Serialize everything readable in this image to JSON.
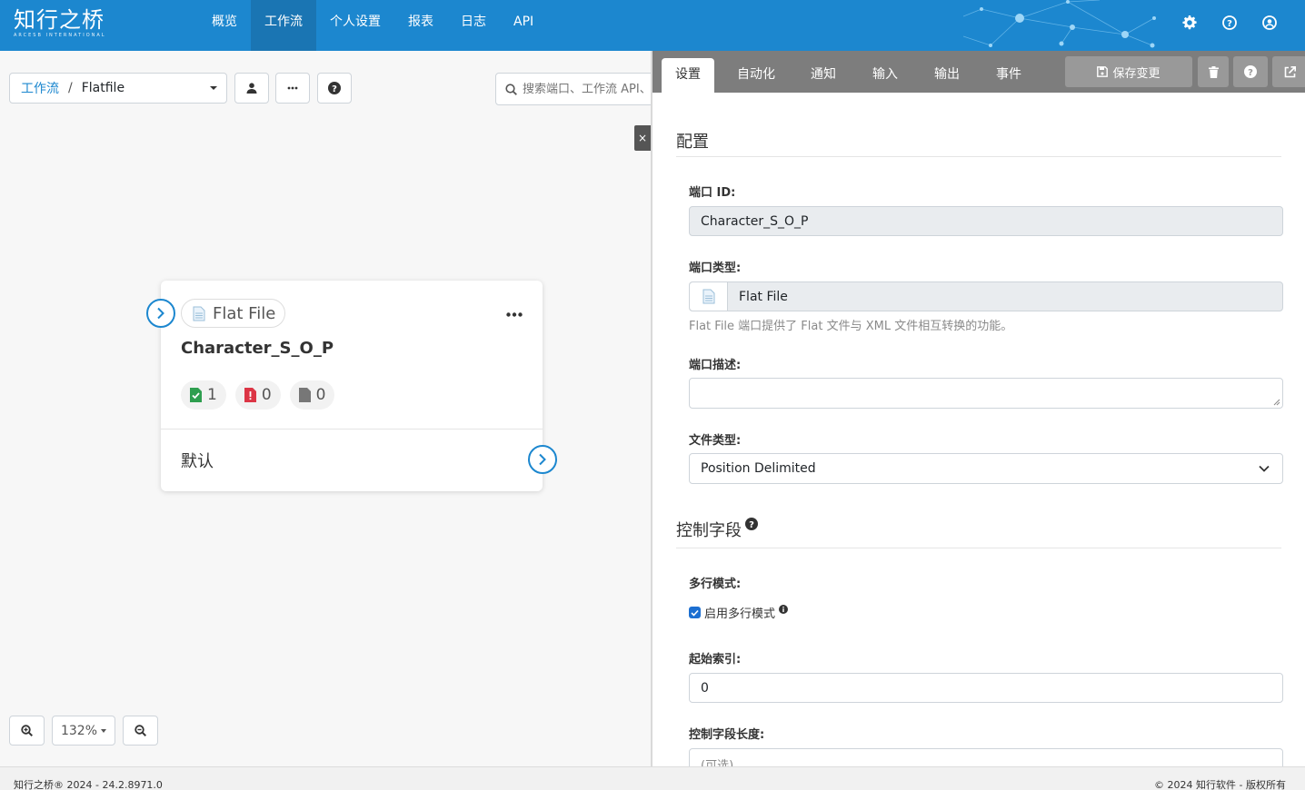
{
  "app": {
    "logo_main": "知行之桥",
    "logo_sub": "ARCESB INTERNATIONAL"
  },
  "nav": {
    "items": [
      {
        "label": "概览"
      },
      {
        "label": "工作流"
      },
      {
        "label": "个人设置"
      },
      {
        "label": "报表"
      },
      {
        "label": "日志"
      },
      {
        "label": "API"
      }
    ],
    "active": "工作流"
  },
  "toolbar": {
    "breadcrumb_root": "工作流",
    "breadcrumb_sep": "/",
    "breadcrumb_current": "Flatfile",
    "search_placeholder": "搜索端口、工作流 API、..."
  },
  "close_label": "×",
  "node": {
    "type_label": "Flat File",
    "title": "Character_S_O_P",
    "success_count": "1",
    "error_count": "0",
    "pending_count": "0",
    "default_label": "默认"
  },
  "zoom": {
    "level": "132%"
  },
  "panel": {
    "tabs": [
      {
        "label": "设置"
      },
      {
        "label": "自动化"
      },
      {
        "label": "通知"
      },
      {
        "label": "输入"
      },
      {
        "label": "输出"
      },
      {
        "label": "事件"
      }
    ],
    "save_label": "保存变更",
    "config_title": "配置",
    "port_id_label": "端口 ID:",
    "port_id_value": "Character_S_O_P",
    "port_type_label": "端口类型:",
    "port_type_value": "Flat File",
    "port_type_help": "Flat File 端口提供了 Flat 文件与 XML 文件相互转换的功能。",
    "port_desc_label": "端口描述:",
    "port_desc_value": "",
    "file_type_label": "文件类型:",
    "file_type_value": "Position Delimited",
    "control_title": "控制字段",
    "multiline_label": "多行模式:",
    "multiline_checkbox_label": "启用多行模式",
    "multiline_checked": true,
    "start_index_label": "起始索引:",
    "start_index_value": "0",
    "control_length_label": "控制字段长度:",
    "control_length_placeholder": "(可选)"
  },
  "footer": {
    "left": "知行之桥® 2024 - 24.2.8971.0",
    "right": "© 2024 知行软件 - 版权所有"
  },
  "colors": {
    "brand": "#1c87cf",
    "success": "#2e9e4f",
    "error": "#dc3545"
  }
}
